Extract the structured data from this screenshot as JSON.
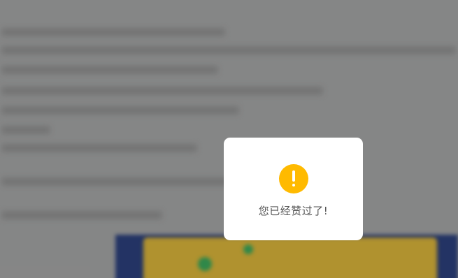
{
  "toast": {
    "icon": "warning-exclamation-icon",
    "message": "您已经赞过了!"
  },
  "colors": {
    "icon_bg": "#ffba00",
    "toast_bg": "#ffffff",
    "message_text": "#555555",
    "backdrop": "#a3a4a4"
  }
}
